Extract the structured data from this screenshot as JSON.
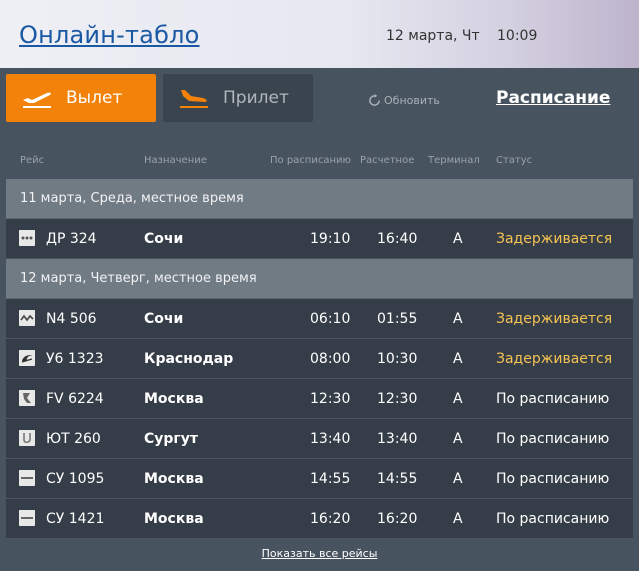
{
  "header": {
    "title": "Онлайн-табло",
    "date": "12 марта, Чт",
    "time": "10:09"
  },
  "tabs": {
    "departure": "Вылет",
    "arrival": "Прилет"
  },
  "refresh_label": "Обновить",
  "schedule_label": "Расписание",
  "columns": {
    "flight": "Рейс",
    "destination": "Назначение",
    "scheduled": "По расписанию",
    "estimated": "Расчетное",
    "terminal": "Терминал",
    "status": "Статус"
  },
  "groups": [
    {
      "date_label": "11 марта, Среда, местное время",
      "flights": [
        {
          "number": "ДР 324",
          "dest": "Сочи",
          "scheduled": "19:10",
          "estimated": "16:40",
          "terminal": "A",
          "status": "Задерживается",
          "status_type": "delay",
          "logo": "dots-logo-icon"
        }
      ]
    },
    {
      "date_label": "12 марта, Четверг, местное время",
      "flights": [
        {
          "number": "N4 506",
          "dest": "Сочи",
          "scheduled": "06:10",
          "estimated": "01:55",
          "terminal": "A",
          "status": "Задерживается",
          "status_type": "delay",
          "logo": "wave-logo-icon"
        },
        {
          "number": "У6 1323",
          "dest": "Краснодар",
          "scheduled": "08:00",
          "estimated": "10:30",
          "terminal": "A",
          "status": "Задерживается",
          "status_type": "delay",
          "logo": "swirl-logo-icon"
        },
        {
          "number": "FV 6224",
          "dest": "Москва",
          "scheduled": "12:30",
          "estimated": "12:30",
          "terminal": "A",
          "status": "По расписанию",
          "status_type": "ok",
          "logo": "r-logo-icon"
        },
        {
          "number": "ЮТ 260",
          "dest": "Сургут",
          "scheduled": "13:40",
          "estimated": "13:40",
          "terminal": "A",
          "status": "По расписанию",
          "status_type": "ok",
          "logo": "u-logo-icon"
        },
        {
          "number": "СУ 1095",
          "dest": "Москва",
          "scheduled": "14:55",
          "estimated": "14:55",
          "terminal": "A",
          "status": "По расписанию",
          "status_type": "ok",
          "logo": "stripe-logo-icon"
        },
        {
          "number": "СУ 1421",
          "dest": "Москва",
          "scheduled": "16:20",
          "estimated": "16:20",
          "terminal": "A",
          "status": "По расписанию",
          "status_type": "ok",
          "logo": "stripe-logo-icon"
        }
      ]
    }
  ],
  "show_all_label": "Показать все рейсы",
  "colors": {
    "accent": "#f2820a",
    "delay": "#f5c253",
    "title_link": "#1b58a4"
  }
}
